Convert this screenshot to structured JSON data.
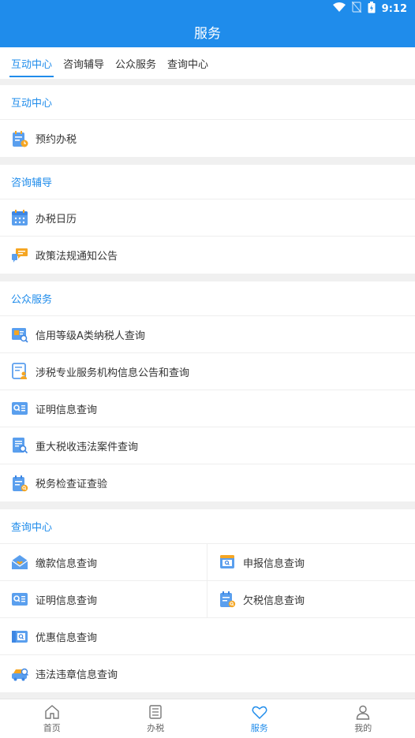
{
  "status": {
    "time": "9:12"
  },
  "header": {
    "title": "服务"
  },
  "tabs": [
    {
      "label": "互动中心"
    },
    {
      "label": "咨询辅导"
    },
    {
      "label": "公众服务"
    },
    {
      "label": "查询中心"
    }
  ],
  "sections": {
    "interactive": {
      "title": "互动中心",
      "items": [
        {
          "label": "预约办税",
          "icon": "appointment-icon"
        }
      ]
    },
    "consult": {
      "title": "咨询辅导",
      "items": [
        {
          "label": "办税日历",
          "icon": "calendar-icon"
        },
        {
          "label": "政策法规通知公告",
          "icon": "chat-bubble-icon"
        }
      ]
    },
    "public": {
      "title": "公众服务",
      "items": [
        {
          "label": "信用等级A类纳税人查询",
          "icon": "credit-search-icon"
        },
        {
          "label": "涉税专业服务机构信息公告和查询",
          "icon": "agency-icon"
        },
        {
          "label": "证明信息查询",
          "icon": "certificate-search-icon"
        },
        {
          "label": "重大税收违法案件查询",
          "icon": "case-search-icon"
        },
        {
          "label": "税务检查证查验",
          "icon": "inspection-icon"
        }
      ]
    },
    "query": {
      "title": "查询中心",
      "grid": [
        {
          "label": "缴款信息查询",
          "icon": "payment-icon"
        },
        {
          "label": "申报信息查询",
          "icon": "declaration-icon"
        },
        {
          "label": "证明信息查询",
          "icon": "certificate-search-icon"
        },
        {
          "label": "欠税信息查询",
          "icon": "arrears-icon"
        }
      ],
      "items": [
        {
          "label": "优惠信息查询",
          "icon": "discount-icon"
        },
        {
          "label": "违法违章信息查询",
          "icon": "car-icon"
        }
      ]
    }
  },
  "bottom_nav": [
    {
      "label": "首页",
      "icon": "home-icon"
    },
    {
      "label": "办税",
      "icon": "list-icon"
    },
    {
      "label": "服务",
      "icon": "heart-icon"
    },
    {
      "label": "我的",
      "icon": "user-icon"
    }
  ],
  "colors": {
    "primary": "#1f8ceb",
    "icon_blue": "#5a9fee",
    "icon_orange": "#f5a623"
  }
}
